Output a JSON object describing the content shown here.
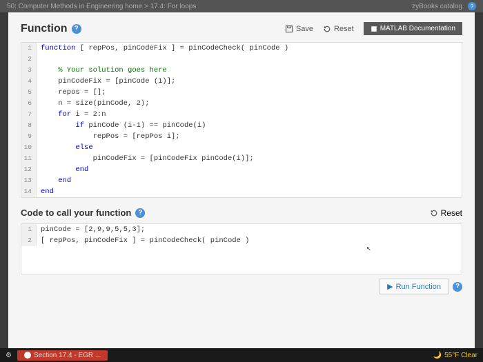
{
  "browser": {
    "breadcrumb": "50: Computer Methods in Engineering home > 17.4: For loops",
    "logo": "zyBooks catalog"
  },
  "func_section": {
    "title": "Function",
    "save": "Save",
    "reset": "Reset",
    "doc": "MATLAB Documentation"
  },
  "code1": {
    "l1a": "function",
    "l1b": " [ repPos, pinCodeFix ] = pinCodeCheck( pinCode )",
    "l3": "    % Your solution goes here",
    "l4": "    pinCodeFix = [pinCode (1)];",
    "l5": "    repos = [];",
    "l6": "    n = size(pinCode, 2);",
    "l7a": "    ",
    "l7b": "for",
    "l7c": " i = 2:n",
    "l8a": "        ",
    "l8b": "if",
    "l8c": " pinCode (i-1) == pinCode(i)",
    "l9": "            repPos = [repPos i];",
    "l10a": "        ",
    "l10b": "else",
    "l11": "            pinCodeFix = [pinCodeFix pinCode(i)];",
    "l12a": "        ",
    "l12b": "end",
    "l13a": "    ",
    "l13b": "end",
    "l14": "end"
  },
  "call_section": {
    "title": "Code to call your function",
    "reset": "Reset"
  },
  "code2": {
    "l1": "pinCode = [2,9,9,5,5,3];",
    "l2": "[ repPos, pinCodeFix ] = pinCodeCheck( pinCode )"
  },
  "run": {
    "label": "Run Function"
  },
  "taskbar": {
    "tab": "Section 17.4 - EGR ...",
    "weather": "55°F Clear"
  },
  "gutters1": [
    "1",
    "2",
    "3",
    "4",
    "5",
    "6",
    "7",
    "8",
    "9",
    "10",
    "11",
    "12",
    "13",
    "14"
  ],
  "gutters2": [
    "1",
    "2"
  ]
}
